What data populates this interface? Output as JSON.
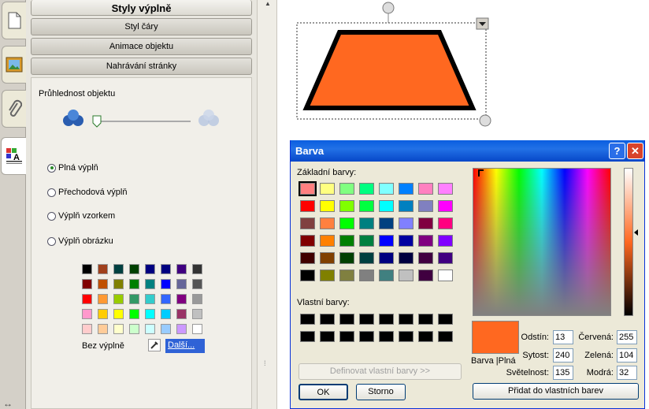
{
  "panel": {
    "title": "Styly výplně",
    "headers": [
      "Styl čáry",
      "Animace objektu",
      "Nahrávání stránky"
    ],
    "transparency_label": "Průhlednost objektu",
    "fill_options": [
      "Plná výplň",
      "Přechodová výplň",
      "Výplň vzorkem",
      "Výplň obrázku"
    ],
    "selected_fill": "Plná výplň",
    "no_fill_label": "Bez výplně",
    "more_label": "Další..."
  },
  "dialog": {
    "title": "Barva",
    "help_glyph": "?",
    "close_glyph": "✕",
    "basic_label": "Základní barvy:",
    "custom_label": "Vlastní barvy:",
    "define_custom": "Definovat vlastní barvy >>",
    "ok": "OK",
    "cancel": "Storno",
    "add_custom": "Přidat do vlastních barev",
    "preview_label": "Barva |Plná",
    "hue_label": "Odstín:",
    "hue": "13",
    "sat_label": "Sytost:",
    "sat": "240",
    "lum_label": "Světelnost:",
    "lum": "135",
    "red_label": "Červená:",
    "red": "255",
    "green_label": "Zelená:",
    "green": "104",
    "blue_label": "Modrá:",
    "blue": "32",
    "current_color": "#ff6820"
  },
  "shape": {
    "fill": "#ff6820",
    "stroke": "#000000"
  }
}
